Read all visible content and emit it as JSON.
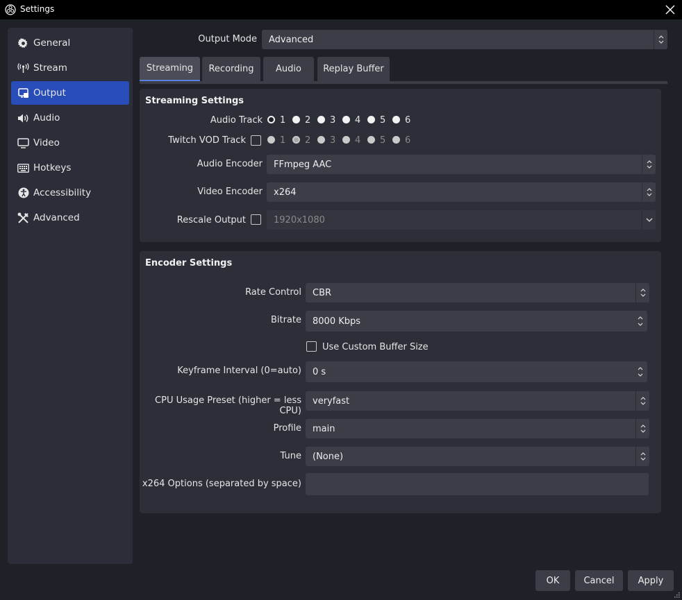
{
  "window": {
    "title": "Settings"
  },
  "sidebar": {
    "items": [
      {
        "label": "General",
        "icon": "gear-icon"
      },
      {
        "label": "Stream",
        "icon": "antenna-icon"
      },
      {
        "label": "Output",
        "icon": "output-icon",
        "active": true
      },
      {
        "label": "Audio",
        "icon": "speaker-icon"
      },
      {
        "label": "Video",
        "icon": "monitor-icon"
      },
      {
        "label": "Hotkeys",
        "icon": "keyboard-icon"
      },
      {
        "label": "Accessibility",
        "icon": "accessibility-icon"
      },
      {
        "label": "Advanced",
        "icon": "tools-icon"
      }
    ]
  },
  "output_mode": {
    "label": "Output Mode",
    "value": "Advanced"
  },
  "tabs": [
    {
      "label": "Streaming",
      "active": true
    },
    {
      "label": "Recording"
    },
    {
      "label": "Audio"
    },
    {
      "label": "Replay Buffer"
    }
  ],
  "streaming": {
    "title": "Streaming Settings",
    "audio_track_label": "Audio Track",
    "audio_tracks": [
      "1",
      "2",
      "3",
      "4",
      "5",
      "6"
    ],
    "twitch_vod_label": "Twitch VOD Track",
    "twitch_tracks": [
      "1",
      "2",
      "3",
      "4",
      "5",
      "6"
    ],
    "audio_encoder_label": "Audio Encoder",
    "audio_encoder_value": "FFmpeg AAC",
    "video_encoder_label": "Video Encoder",
    "video_encoder_value": "x264",
    "rescale_label": "Rescale Output",
    "rescale_value": "1920x1080"
  },
  "encoder": {
    "title": "Encoder Settings",
    "rate_control_label": "Rate Control",
    "rate_control_value": "CBR",
    "bitrate_label": "Bitrate",
    "bitrate_value": "8000 Kbps",
    "custom_buffer_label": "Use Custom Buffer Size",
    "keyframe_label": "Keyframe Interval (0=auto)",
    "keyframe_value": "0 s",
    "cpu_preset_label": "CPU Usage Preset (higher = less CPU)",
    "cpu_preset_value": "veryfast",
    "profile_label": "Profile",
    "profile_value": "main",
    "tune_label": "Tune",
    "tune_value": "(None)",
    "x264_options_label": "x264 Options (separated by space)",
    "x264_options_value": ""
  },
  "buttons": {
    "ok": "OK",
    "cancel": "Cancel",
    "apply": "Apply"
  },
  "colors": {
    "accent": "#284cb8",
    "background": "#1f2129",
    "panel": "#2c2f38",
    "field": "#3b3e47"
  }
}
